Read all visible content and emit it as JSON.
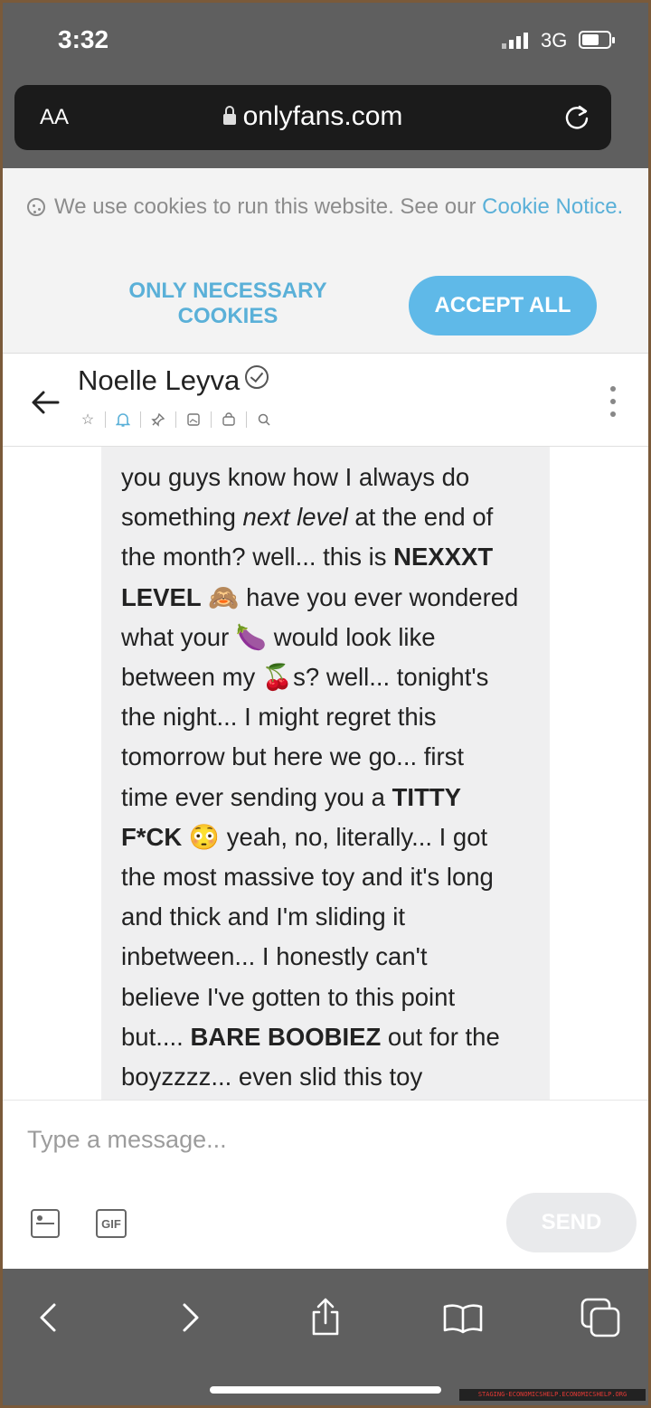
{
  "status_bar": {
    "time": "3:32",
    "network": "3G"
  },
  "browser": {
    "text_size_label": "AA",
    "domain": "onlyfans.com"
  },
  "cookie_banner": {
    "text": "We use cookies to run this website. See our",
    "link": "Cookie Notice.",
    "necessary_label": "ONLY NECESSARY COOKIES",
    "accept_label": "ACCEPT ALL"
  },
  "chat": {
    "contact_name": "Noelle Leyva"
  },
  "message_lines": [
    "you guys know how I always do",
    "something <i>next level</i> at the end of",
    "the month? well... this is <b>NEXXXT</b>",
    "<b>LEVEL</b> 🙈 have you ever wondered",
    "what your 🍆 would look like",
    "between my 🍒s? well... tonight's",
    "the night... I might regret this",
    "tomorrow but here we go... first",
    "time ever sending you a <b>TITTY</b>",
    "<b>F*CK</b> 😳 yeah, no, literally... I got",
    "the most massive toy and it's long",
    "and thick and I'm sliding it",
    "inbetween... I honestly can't",
    "believe I've gotten to this point",
    "but.... <b>BARE BOOBIEZ</b> out for the",
    "boyzzzz... even slid this toy"
  ],
  "composer": {
    "placeholder": "Type a message...",
    "gif_label": "GIF",
    "send_label": "SEND"
  },
  "watermark": "STAGING-ECONOMICSHELP.ECONOMICSHELP.ORG",
  "colors": {
    "accent": "#5ab0d8",
    "chrome": "#5f5f5f",
    "bubble": "#efeff0"
  }
}
